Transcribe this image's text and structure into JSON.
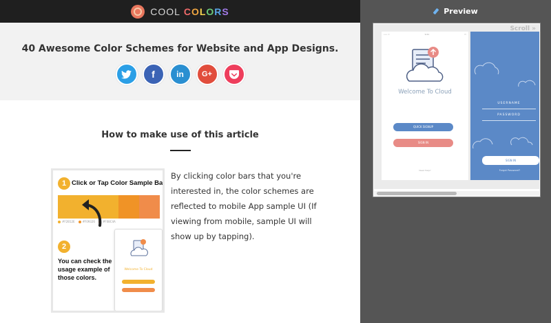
{
  "brand": {
    "word1": "COOL",
    "word2_letters": [
      "C",
      "O",
      "L",
      "O",
      "R",
      "S"
    ],
    "letter_colors": [
      "#f06a6a",
      "#f0a641",
      "#f5d34f",
      "#6ccb7a",
      "#5aa6e8",
      "#a27ae8"
    ]
  },
  "hero": {
    "title": "40 Awesome Color Schemes for Website and App Designs.",
    "social": [
      {
        "name": "twitter",
        "glyph": "🐦",
        "color": "#2b9fe6"
      },
      {
        "name": "facebook",
        "glyph": "f",
        "color": "#3b63b5"
      },
      {
        "name": "linkedin",
        "glyph": "in",
        "color": "#2a8fd1"
      },
      {
        "name": "google-plus",
        "glyph": "G+",
        "color": "#e14d3c"
      },
      {
        "name": "pocket",
        "glyph": "⌄",
        "color": "#ee3e5c"
      }
    ]
  },
  "section": {
    "title": "How to make use of this article",
    "description": "By clicking color bars that you're interested in, the color schemes are reflected to mobile App sample UI (If viewing from mobile, sample UI will show up by tapping)."
  },
  "guide": {
    "step1_num": "1",
    "step1_text": "Click or Tap Color Sample Bar.",
    "step2_num": "2",
    "step2_text": "You can check the usage example of those colors.",
    "bar_colors": [
      "#f2b12e",
      "#f09326",
      "#f08c4a"
    ],
    "mini_title": "Welcome To Cloud"
  },
  "preview": {
    "header": "Preview",
    "scroll_label": "Scroll »",
    "phone1": {
      "status_left": "••• ≈",
      "status_time": "9:41",
      "status_right": "▭",
      "welcome": "Welcome To Cloud",
      "quick_signup": "QUICK SIGNUP",
      "sign_in": "SIGN IN",
      "help": "Need Help?",
      "accent": "#5b89c7",
      "secondary": "#e88b86"
    },
    "phone2": {
      "username": "USERNAME",
      "password": "PASSWORD",
      "sign_in": "SIGN IN",
      "forgot": "Forgot Password?",
      "background": "#5b89c7"
    }
  }
}
